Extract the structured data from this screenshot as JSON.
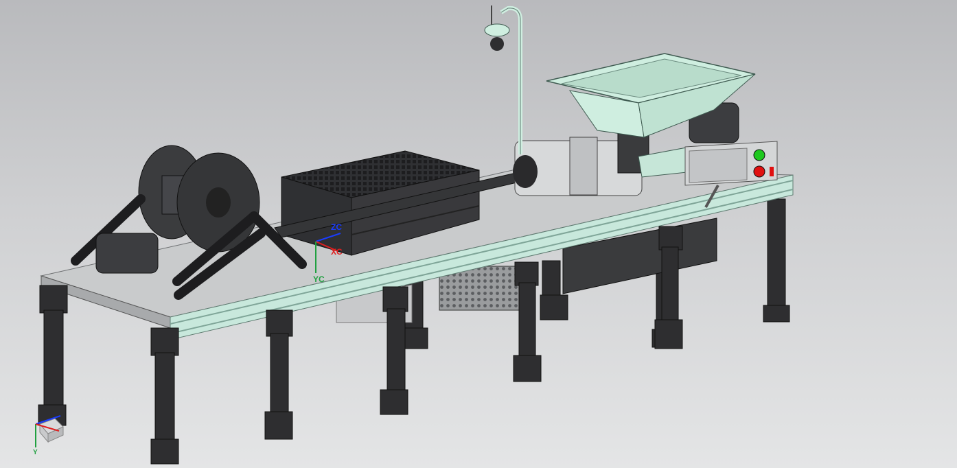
{
  "viewport": {
    "background_top": "#b9babd",
    "background_bottom": "#e4e5e6"
  },
  "model": {
    "frame_color": "#2e2e30",
    "deck_color": "#c9cbcc",
    "rail_color": "#c8e8dc",
    "hopper_color": "#cfeee0",
    "pipe_color": "#cfeee0",
    "button_start_color": "#1ec81e",
    "button_stop_color": "#e01010"
  },
  "wcs_triad": {
    "z_label": "ZC",
    "x_label": "XC",
    "y_label": "YC",
    "z_color": "#1a3cff",
    "x_color": "#e02020",
    "y_color": "#20a040"
  },
  "abs_triad": {
    "y_label": "Y",
    "icon": "csys-cube-icon"
  }
}
